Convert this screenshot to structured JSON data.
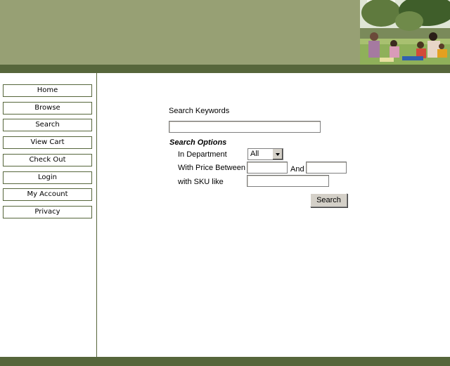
{
  "nav": {
    "items": [
      "Home",
      "Browse",
      "Search",
      "View Cart",
      "Check Out",
      "Login",
      "My Account",
      "Privacy"
    ]
  },
  "search": {
    "keywords_label": "Search Keywords",
    "keywords_value": "",
    "options_heading": "Search Options",
    "department_label": "In Department",
    "department_selected": "All",
    "price_label": "With Price Between",
    "price_min_value": "",
    "and_label": "And",
    "price_max_value": "",
    "sku_label": "with SKU like",
    "sku_value": "",
    "button_label": "Search"
  },
  "colors": {
    "header_green": "#97a074",
    "band_green": "#56663b"
  }
}
